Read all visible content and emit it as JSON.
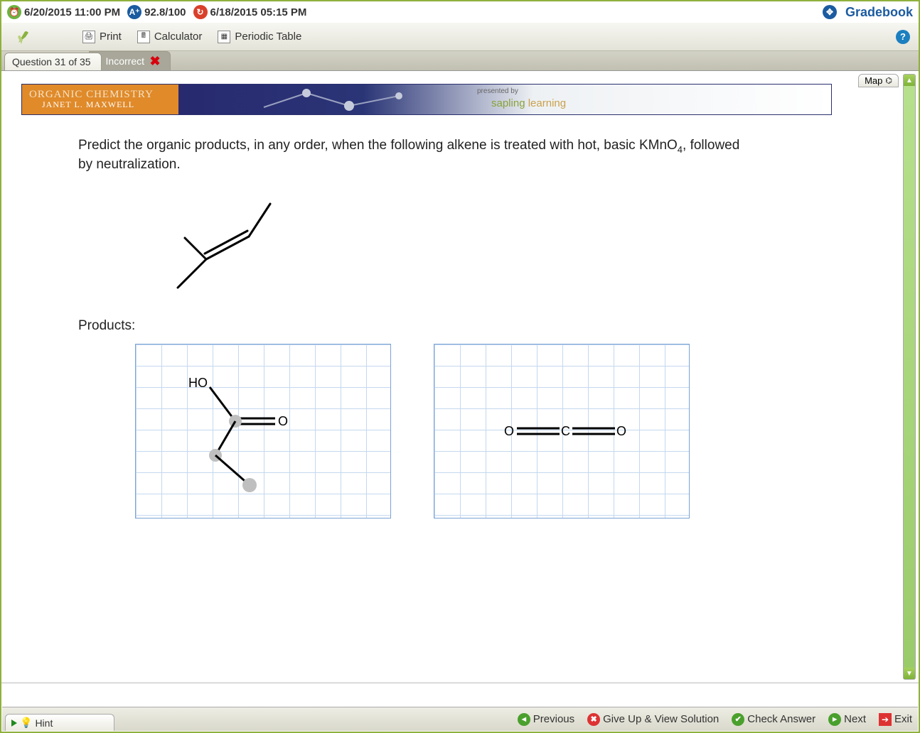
{
  "status": {
    "due_date": "6/20/2015 11:00 PM",
    "grade": "92.8/100",
    "last_attempt": "6/18/2015 05:15 PM",
    "gradebook": "Gradebook"
  },
  "toolbar": {
    "print": "Print",
    "calculator": "Calculator",
    "periodic_table": "Periodic Table"
  },
  "question_tab": {
    "label": "Question 31 of 35",
    "status": "Incorrect"
  },
  "banner": {
    "course": "ORGANIC CHEMISTRY",
    "author": "JANET L. MAXWELL",
    "presented_by": "presented by",
    "brand_a": "sapling",
    "brand_b": "learning",
    "map": "Map"
  },
  "question": {
    "text_a": "Predict the organic products, in any order, when the following alkene is treated with hot, basic KMnO",
    "sub4": "4",
    "text_b": ", followed by neutralization.",
    "products_label": "Products:",
    "p1_ho": "HO",
    "p1_o": "O",
    "p2_o_left": "O",
    "p2_c": "C",
    "p2_o_right": "O"
  },
  "bottom": {
    "hint": "Hint",
    "previous": "Previous",
    "give_up": "Give Up & View Solution",
    "check": "Check Answer",
    "next": "Next",
    "exit": "Exit"
  }
}
